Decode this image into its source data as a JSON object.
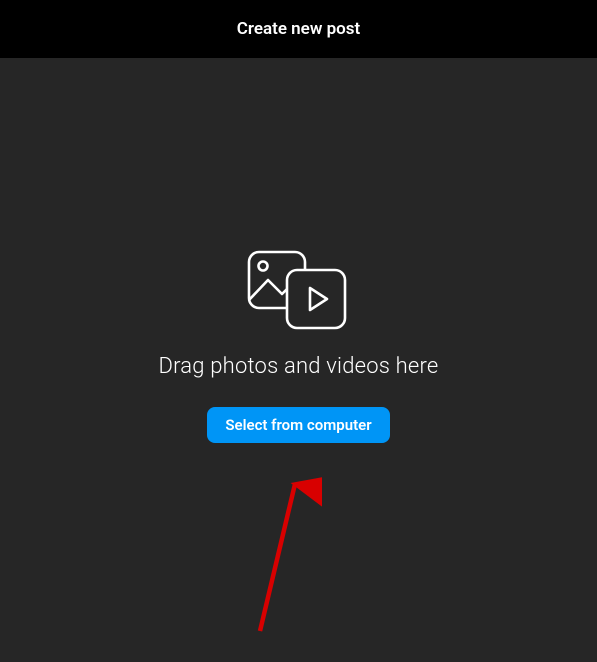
{
  "header": {
    "title": "Create new post"
  },
  "dropzone": {
    "prompt_text": "Drag photos and videos here",
    "select_button_label": "Select from computer"
  },
  "annotation": {
    "arrow_color": "#d80000"
  }
}
